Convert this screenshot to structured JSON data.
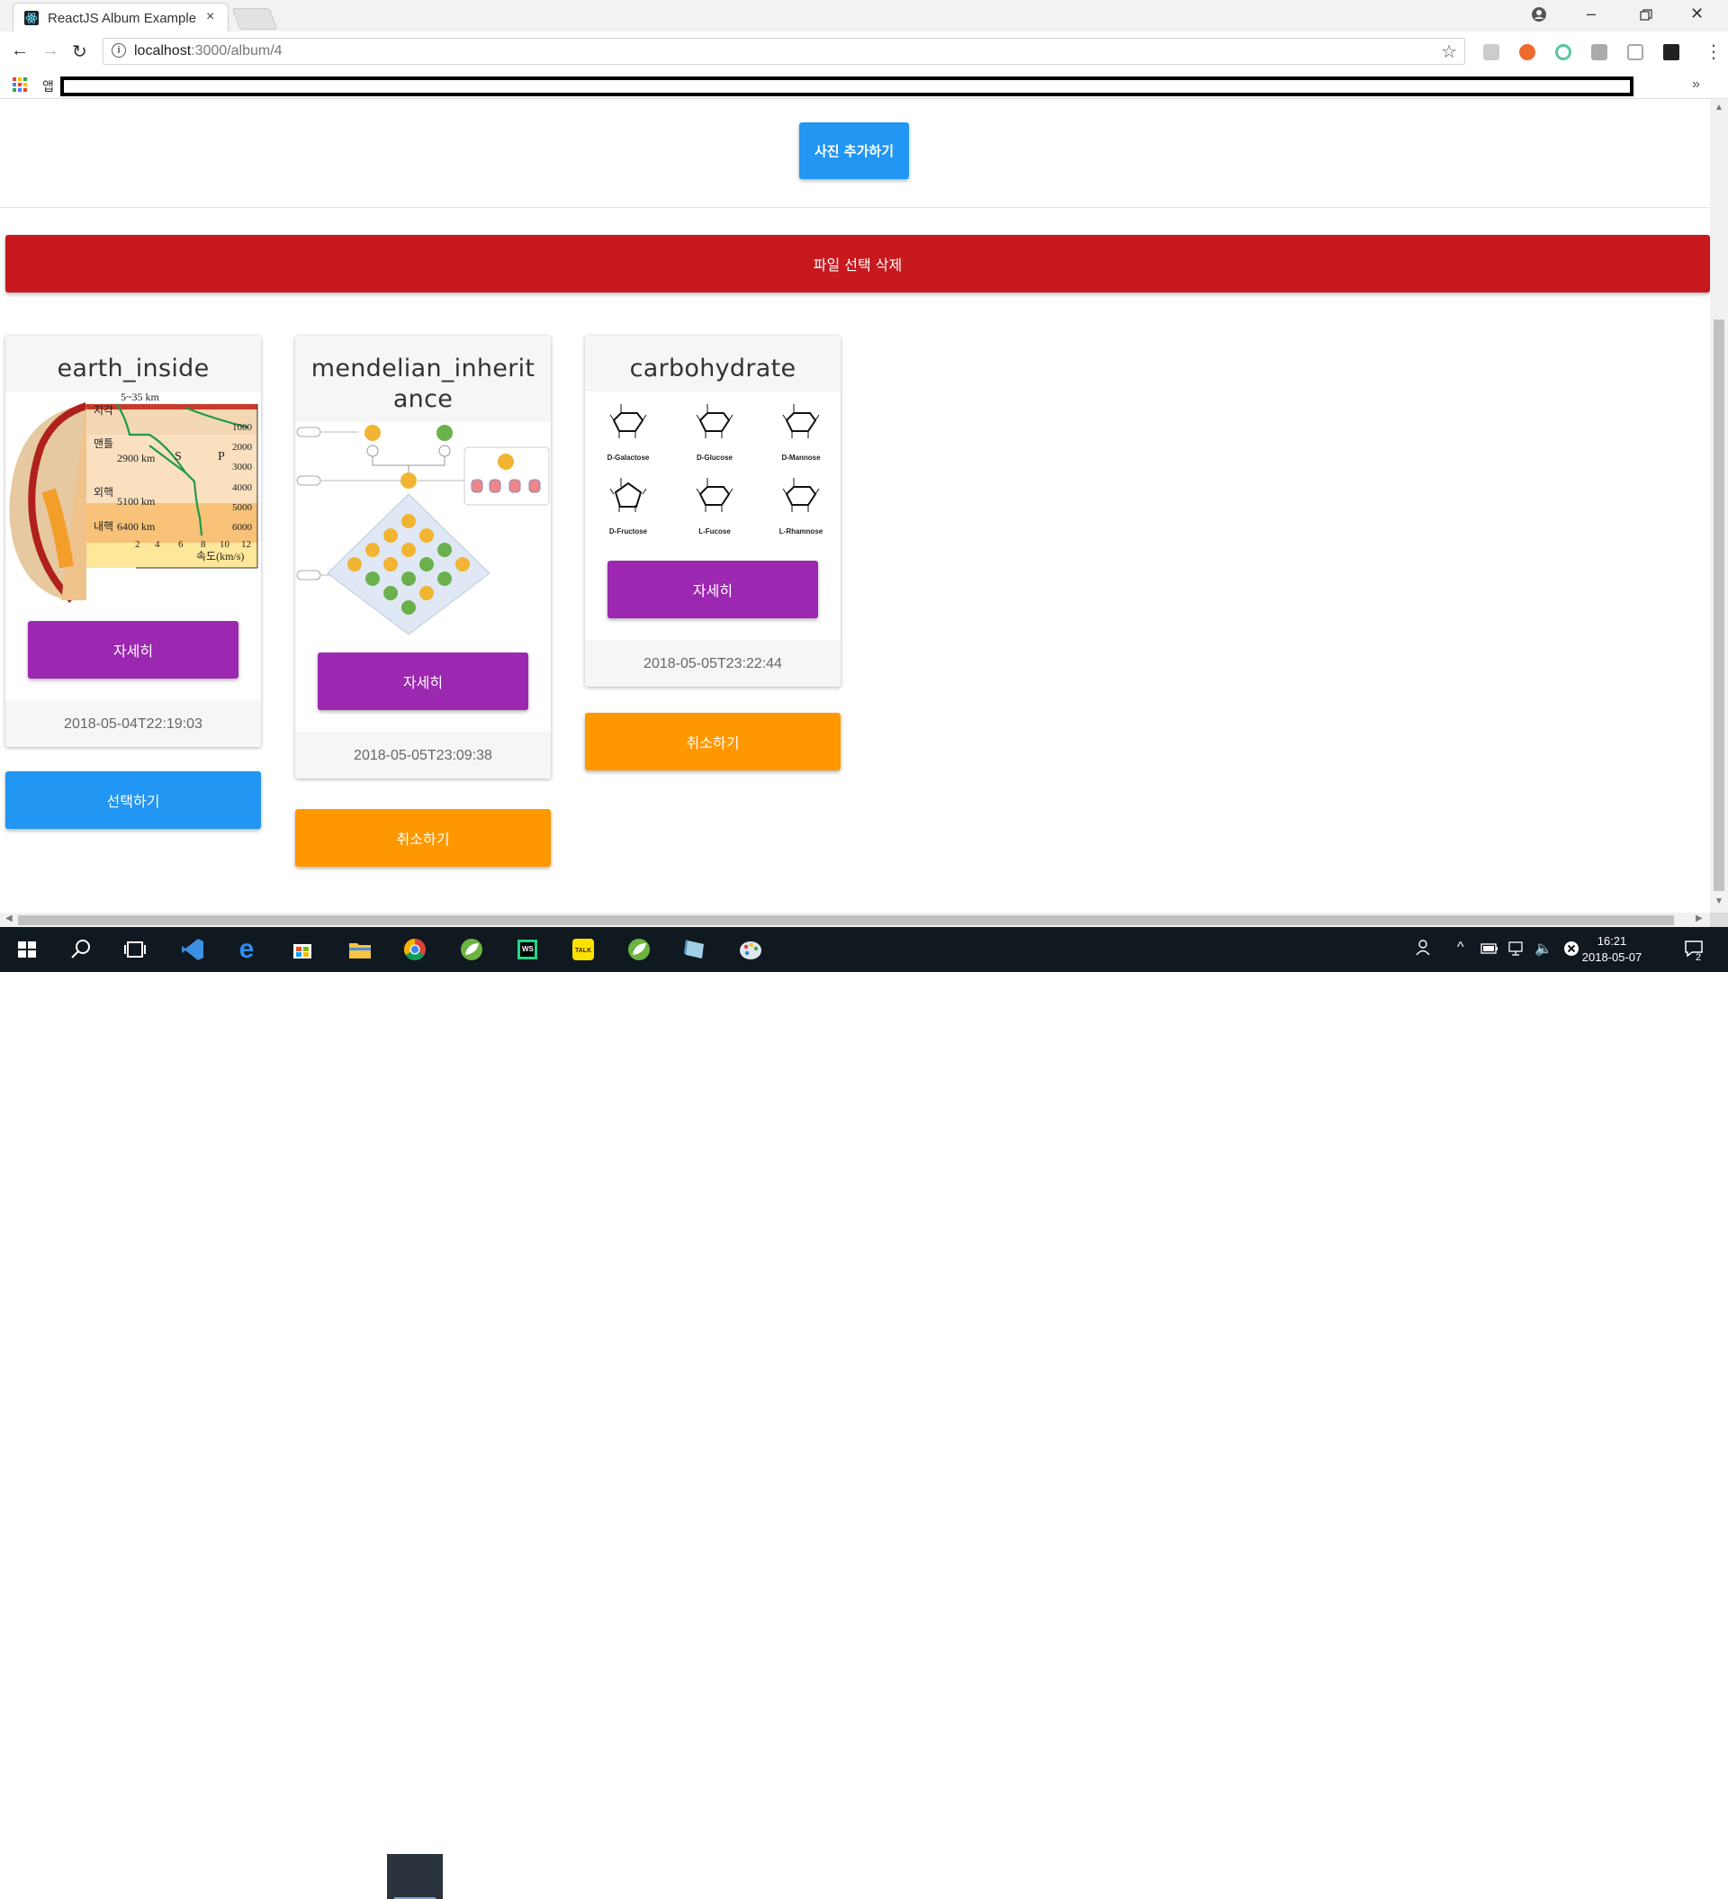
{
  "browser": {
    "tab_title": "ReactJS Album Example",
    "tab_close": "×",
    "url_host": "localhost",
    "url_path": ":3000/album/4",
    "apps_label": "앱",
    "bookmarks_more": "»"
  },
  "page": {
    "add_photo_label": "사진 추가하기",
    "delete_selected_label": "파일 선택 삭제",
    "cards": [
      {
        "title": "earth_inside",
        "detail_label": "자세히",
        "date": "2018-05-04T22:19:03",
        "action_label": "선택하기",
        "image_labels": [
          "5~35 km",
          "2900 km",
          "5100 km",
          "6400 km",
          "S",
          "P",
          "1000",
          "2000",
          "3000",
          "4000",
          "5000",
          "6000",
          "2",
          "4",
          "6",
          "8",
          "10",
          "12",
          "속도(km/s)",
          "지각",
          "맨틀",
          "외핵",
          "내핵"
        ]
      },
      {
        "title": "mendelian_inheritance",
        "detail_label": "자세히",
        "date": "2018-05-05T23:09:38",
        "action_label": "취소하기"
      },
      {
        "title": "carbohydrate",
        "detail_label": "자세히",
        "date": "2018-05-05T23:22:44",
        "action_label": "취소하기",
        "image_labels": [
          "D-Galactose",
          "D-Glucose",
          "D-Mannose",
          "D-Fructose",
          "L-Fucose",
          "L-Rhamnose"
        ]
      }
    ]
  },
  "taskbar": {
    "time": "16:21",
    "date": "2018-05-07",
    "notification_count": "2"
  },
  "colors": {
    "primary_blue": "#2196f3",
    "delete_red": "#c8191f",
    "detail_purple": "#9c27b0",
    "cancel_orange": "#ff9800"
  }
}
